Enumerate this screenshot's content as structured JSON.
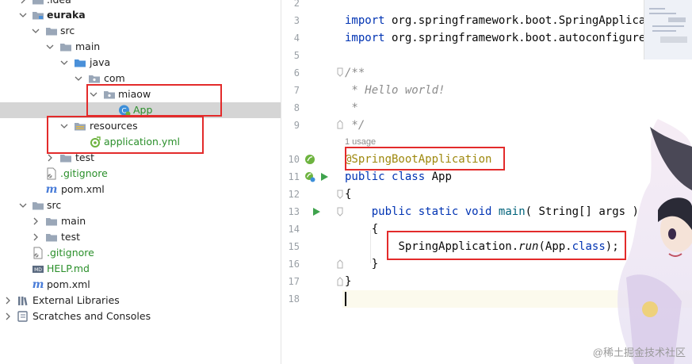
{
  "tree": {
    "idea_label": ".idea",
    "euraka_label": "euraka",
    "src_label": "src",
    "main_label": "main",
    "java_label": "java",
    "com_label": "com",
    "miaow_label": "miaow",
    "app_label": "App",
    "resources_label": "resources",
    "application_yml_label": "application.yml",
    "test_label": "test",
    "gitignore_label": ".gitignore",
    "pom_label": "pom.xml",
    "root_src_label": "src",
    "root_main_label": "main",
    "root_test_label": "test",
    "root_gitignore_label": ".gitignore",
    "help_label": "HELP.md",
    "root_pom_label": "pom.xml",
    "external_libraries_label": "External Libraries",
    "scratches_label": "Scratches and Consoles",
    "icons": {
      "folder_color": "#9aa7b8",
      "source_folder_color": "#4a90d9",
      "spring_color": "#6db33f"
    }
  },
  "editor": {
    "line_numbers": [
      "2",
      "3",
      "4",
      "5",
      "6",
      "7",
      "8",
      "9",
      "10",
      "11",
      "12",
      "13",
      "14",
      "15",
      "16",
      "17",
      "18"
    ],
    "line3": {
      "kw": "import",
      "text": " org.springframework.boot.SpringApplicati"
    },
    "line4": {
      "kw": "import",
      "text": " org.springframework.boot.autoconfigure.S"
    },
    "line6": "/**",
    "line7": " * Hello world!",
    "line8": " *",
    "line9": " */",
    "usage": "1 usage",
    "line10": "@SpringBootApplication",
    "line11": {
      "kw1": "public",
      "kw2": "class",
      "name": "App"
    },
    "line12": "{",
    "line13": {
      "kw1": "public",
      "kw2": "static",
      "kw3": "void",
      "name": "main",
      "params": "( String[] args )"
    },
    "line14": "{",
    "line15": {
      "cls": "SpringApplication",
      "dot": ".",
      "method": "run",
      "open": "(App.",
      "kw": "class",
      "close": ");"
    },
    "line16": "}",
    "line17": "}"
  },
  "watermark": "@稀土掘金技术社区"
}
